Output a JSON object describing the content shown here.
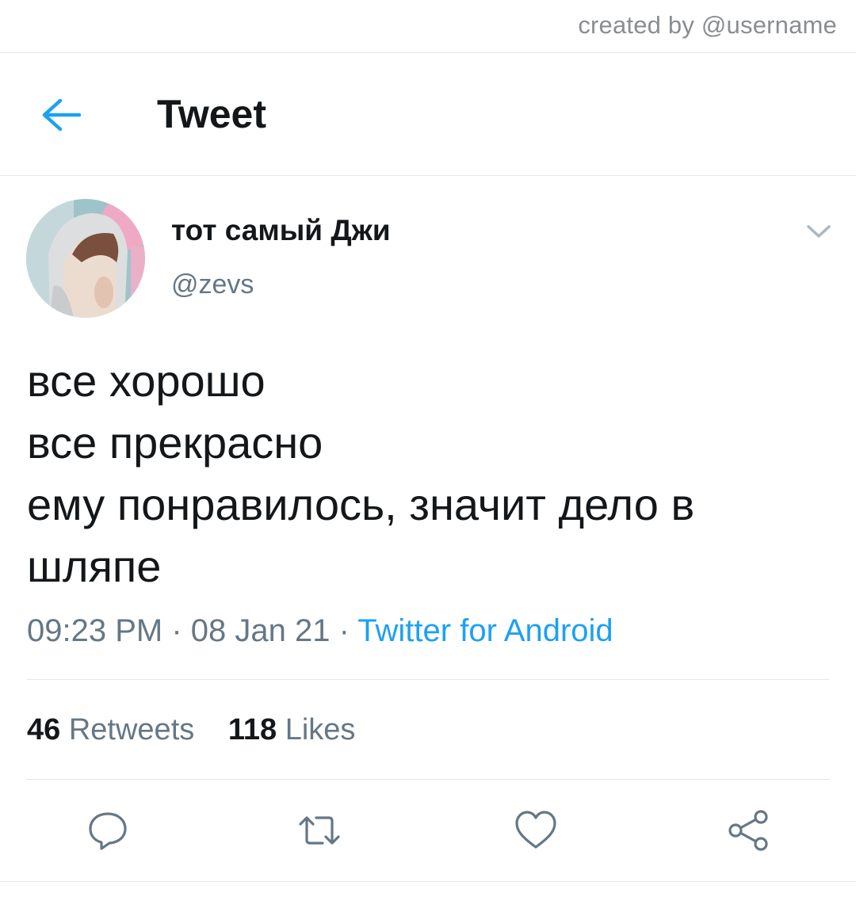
{
  "watermark": "created by @username",
  "header": {
    "title": "Tweet"
  },
  "tweet": {
    "display_name": "тот самый Джи",
    "handle": "@zevs",
    "lines": [
      "все хорошо",
      "все прекрасно",
      "ему понравилось, значит дело в",
      "шляпе"
    ],
    "time": "09:23 PM",
    "date": "08 Jan 21",
    "separator": " · ",
    "source": "Twitter for Android",
    "retweets_count": "46",
    "retweets_label": "Retweets",
    "likes_count": "118",
    "likes_label": "Likes"
  },
  "icons": {
    "back": "arrow-left-icon",
    "more": "chevron-down-icon",
    "reply": "reply-bubble-icon",
    "retweet": "retweet-icon",
    "like": "heart-icon",
    "share": "share-icon"
  },
  "colors": {
    "accent": "#1da1f2",
    "text_primary": "#14171a",
    "text_secondary": "#657786",
    "divider": "#e1e8ed"
  }
}
